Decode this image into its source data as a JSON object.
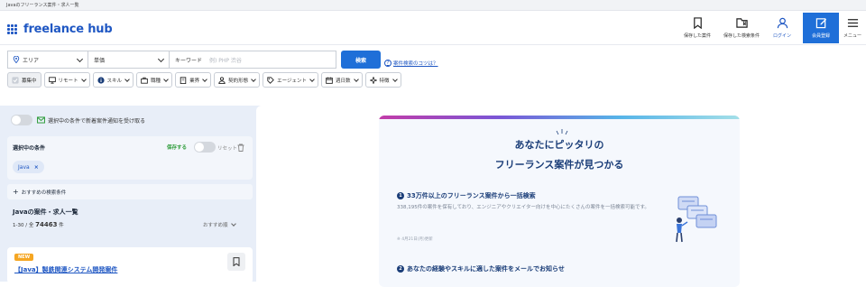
{
  "browser": {
    "title": "Javaのフリーランス案件・求人一覧"
  },
  "header": {
    "logo_text": "freelance hub",
    "nav": [
      {
        "label": "保存した案件",
        "icon": "bookmark-icon"
      },
      {
        "label": "保存した検索条件",
        "icon": "folder-bookmark-icon"
      },
      {
        "label": "ログイン",
        "icon": "user-icon"
      },
      {
        "label": "会員登録",
        "icon": "edit-icon"
      },
      {
        "label": "メニュー",
        "icon": "menu-icon"
      }
    ]
  },
  "search": {
    "area_label": "エリア",
    "price_label": "単価",
    "keyword_label": "キーワード",
    "keyword_placeholder": "例) PHP 渋谷",
    "search_button": "検索",
    "tips_link": "案件検索のコツは？"
  },
  "filters": [
    {
      "label": "募集中",
      "icon": "check-icon"
    },
    {
      "label": "リモート",
      "icon": "monitor-icon"
    },
    {
      "label": "スキル",
      "icon": "info-icon"
    },
    {
      "label": "職種",
      "icon": "briefcase-icon"
    },
    {
      "label": "業界",
      "icon": "building-icon"
    },
    {
      "label": "契約形態",
      "icon": "person-icon"
    },
    {
      "label": "エージェント",
      "icon": "tag-icon"
    },
    {
      "label": "週日数",
      "icon": "calendar-icon"
    },
    {
      "label": "特徴",
      "icon": "sparkle-icon"
    }
  ],
  "sidebar": {
    "notify_label": "選択中の条件で新着案件通知を受け取る",
    "selected_title": "選択中の条件",
    "save_label": "保存する",
    "reset_label": "リセット",
    "selected_tag": "Java",
    "recommend_label": "おすすめの検索条件",
    "list_title": "Javaの案件・求人一覧",
    "count_prefix": "1-30 / 全",
    "count_total": "74463",
    "count_suffix": "件",
    "sort_label": "おすすめ順",
    "first_job": {
      "badge": "NEW",
      "title": "【Java】製鉄関連システム開発案件"
    }
  },
  "promo": {
    "headline_1": "あなたにピッタリの",
    "headline_2": "フリーランス案件が見つかる",
    "point1_title": "33万件以上のフリーランス案件から一括検索",
    "point1_desc": "338,195件の案件を保有しており、エンジニアやクリエイター向けを中心にたくさんの案件を一括検索可能です。",
    "point1_note": "※ 4月21日(月)更新",
    "point2_title": "あなたの経験やスキルに適した案件をメールでお知らせ"
  },
  "colors": {
    "brand": "#1f57c3",
    "button": "#1f6fd8",
    "background": "#e8eef8"
  }
}
